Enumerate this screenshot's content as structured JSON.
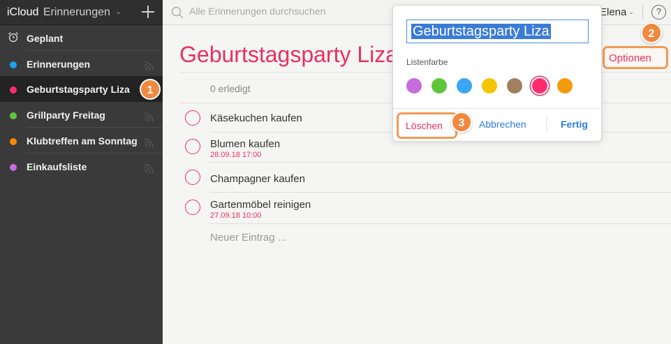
{
  "header": {
    "brand": "iCloud",
    "app": "Erinnerungen"
  },
  "search": {
    "placeholder": "Alle Erinnerungen durchsuchen"
  },
  "user": {
    "name": "Elena"
  },
  "help_label": "?",
  "sidebar": {
    "items": [
      {
        "label": "Geplant",
        "icon": "alarm-clock-icon"
      },
      {
        "label": "Erinnerungen",
        "color": "#1aa1f1"
      },
      {
        "label": "Geburtstagsparty Liza",
        "color": "#ff2d6e",
        "active": true
      },
      {
        "label": "Grillparty Freitag",
        "color": "#5ec63b"
      },
      {
        "label": "Klubtreffen am Sonntag",
        "color": "#ff8a00"
      },
      {
        "label": "Einkaufsliste",
        "color": "#c66ddd"
      }
    ]
  },
  "list": {
    "title": "Geburtstagsparty Liza",
    "completed_label": "0 erledigt",
    "options_label": "Optionen",
    "new_entry_placeholder": "Neuer Eintrag ...",
    "tasks": [
      {
        "title": "Käsekuchen kaufen",
        "due": ""
      },
      {
        "title": "Blumen kaufen",
        "due": "28.09.18 17:00"
      },
      {
        "title": "Champagner kaufen",
        "due": ""
      },
      {
        "title": "Gartenmöbel reinigen",
        "due": "27.09.18 10:00"
      }
    ]
  },
  "popover": {
    "name_value": "Geburtstagsparty Liza",
    "color_label": "Listenfarbe",
    "colors": [
      "#c66ddd",
      "#5ec63b",
      "#3aa6f5",
      "#f5c400",
      "#a08060",
      "#ff2d6e",
      "#f59a0c"
    ],
    "selected_color": "#ff2d6e",
    "delete_label": "Löschen",
    "cancel_label": "Abbrechen",
    "done_label": "Fertig"
  },
  "annotations": {
    "one": "1",
    "two": "2",
    "three": "3"
  }
}
